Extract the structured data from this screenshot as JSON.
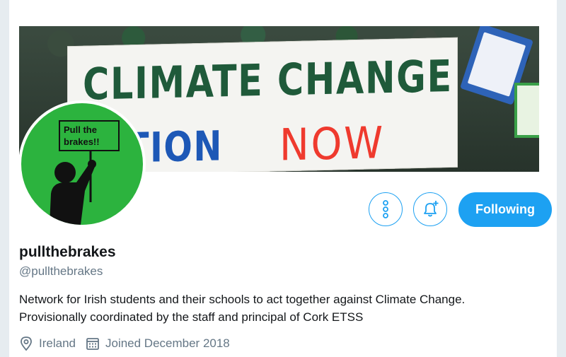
{
  "banner": {
    "line1": "CLIMATE CHANGE",
    "line2a": "ACTION",
    "line2b": "NOW"
  },
  "avatar": {
    "sign_line1": "Pull the",
    "sign_line2": "brakes!!"
  },
  "actions": {
    "more_icon": "more-vertical-icon",
    "notify_icon": "bell-plus-icon",
    "following_label": "Following"
  },
  "profile": {
    "display_name": "pullthebrakes",
    "handle": "@pullthebrakes",
    "bio_line1": "Network for Irish students and their schools to act together against Climate Change.",
    "bio_line2": "Provisionally coordinated by the staff and principal of Cork ETSS",
    "location": "Ireland",
    "joined": "Joined December 2018"
  },
  "colors": {
    "accent": "#1da1f2",
    "secondary_text": "#657786",
    "avatar_bg": "#2cb33e"
  }
}
